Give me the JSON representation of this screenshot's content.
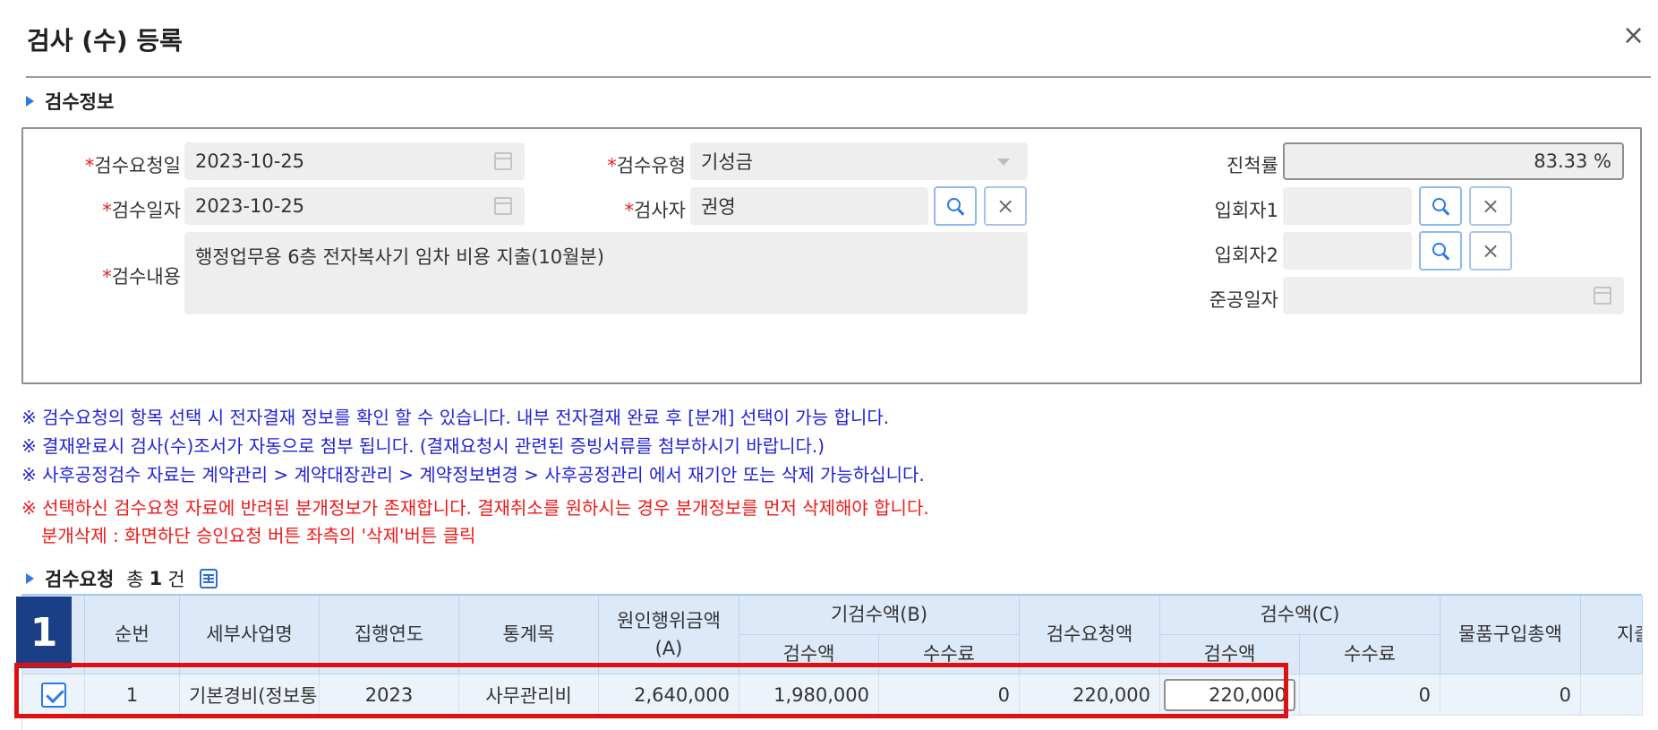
{
  "dialog": {
    "title": "검사 (수) 등록",
    "close_label": "×"
  },
  "section_info": {
    "title": "검수정보"
  },
  "form": {
    "required_mark": "*",
    "request_date": {
      "label": "검수요청일",
      "value": "2023-10-25"
    },
    "inspect_date": {
      "label": "검수일자",
      "value": "2023-10-25"
    },
    "content": {
      "label": "검수내용",
      "value": "행정업무용 6층 전자복사기 임차 비용 지출(10월분)"
    },
    "type": {
      "label": "검수유형",
      "value": "기성금"
    },
    "inspector": {
      "label": "검사자",
      "value": "권영"
    },
    "progress": {
      "label": "진척률",
      "value": "83.33 %"
    },
    "witness1": {
      "label": "입회자1",
      "value": ""
    },
    "witness2": {
      "label": "입회자2",
      "value": ""
    },
    "completion_date": {
      "label": "준공일자",
      "value": ""
    }
  },
  "notes": {
    "blue": [
      "※ 검수요청의 항목 선택 시 전자결재 정보를 확인 할 수 있습니다. 내부 전자결재 완료 후 [분개] 선택이 가능 합니다.",
      "※ 결재완료시 검사(수)조서가 자동으로 첨부 됩니다. (결재요청시 관련된 증빙서류를 첨부하시기 바랍니다.)",
      "※ 사후공정검수 자료는 계약관리 > 계약대장관리 > 계약정보변경 > 사후공정관리 에서 재기안 또는 삭제 가능하십니다."
    ],
    "red": [
      "※ 선택하신 검수요청 자료에 반려된 분개정보가 존재합니다. 결재취소를 원하시는 경우 분개정보를 먼저 삭제해야 합니다.",
      "분개삭제 : 화면하단 승인요청 버튼 좌측의 '삭제'버튼 클릭"
    ]
  },
  "section_request": {
    "title": "검수요청",
    "total_label": "총",
    "count": "1",
    "unit": "건"
  },
  "table": {
    "headers": {
      "seq": "순번",
      "biz": "세부사업명",
      "year": "집행연도",
      "account": "통계목",
      "orig": "원인행위금액\n(A)",
      "prev_group": "기검수액(B)",
      "prev_amt": "검수액",
      "prev_fee": "수수료",
      "req_amt": "검수요청액",
      "cur_group": "검수액(C)",
      "cur_amt": "검수액",
      "cur_fee": "수수료",
      "purchase": "물품구입총액",
      "expense": "지출금"
    },
    "rows": [
      {
        "seq": "1",
        "biz": "기본경비(정보통",
        "year": "2023",
        "account": "사무관리비",
        "orig": "2,640,000",
        "prev_amt": "1,980,000",
        "prev_fee": "0",
        "req_amt": "220,000",
        "cur_amt": "220,000",
        "cur_fee": "0",
        "purchase": "0",
        "expense": ""
      }
    ]
  },
  "annotation": {
    "badge": "1"
  },
  "colors": {
    "accent": "#2a7ae2",
    "header_bg": "#dce9f9",
    "highlight": "#e01010",
    "badge_bg": "#1b3f86",
    "note_blue": "#2222d8",
    "note_red": "#f01818"
  }
}
